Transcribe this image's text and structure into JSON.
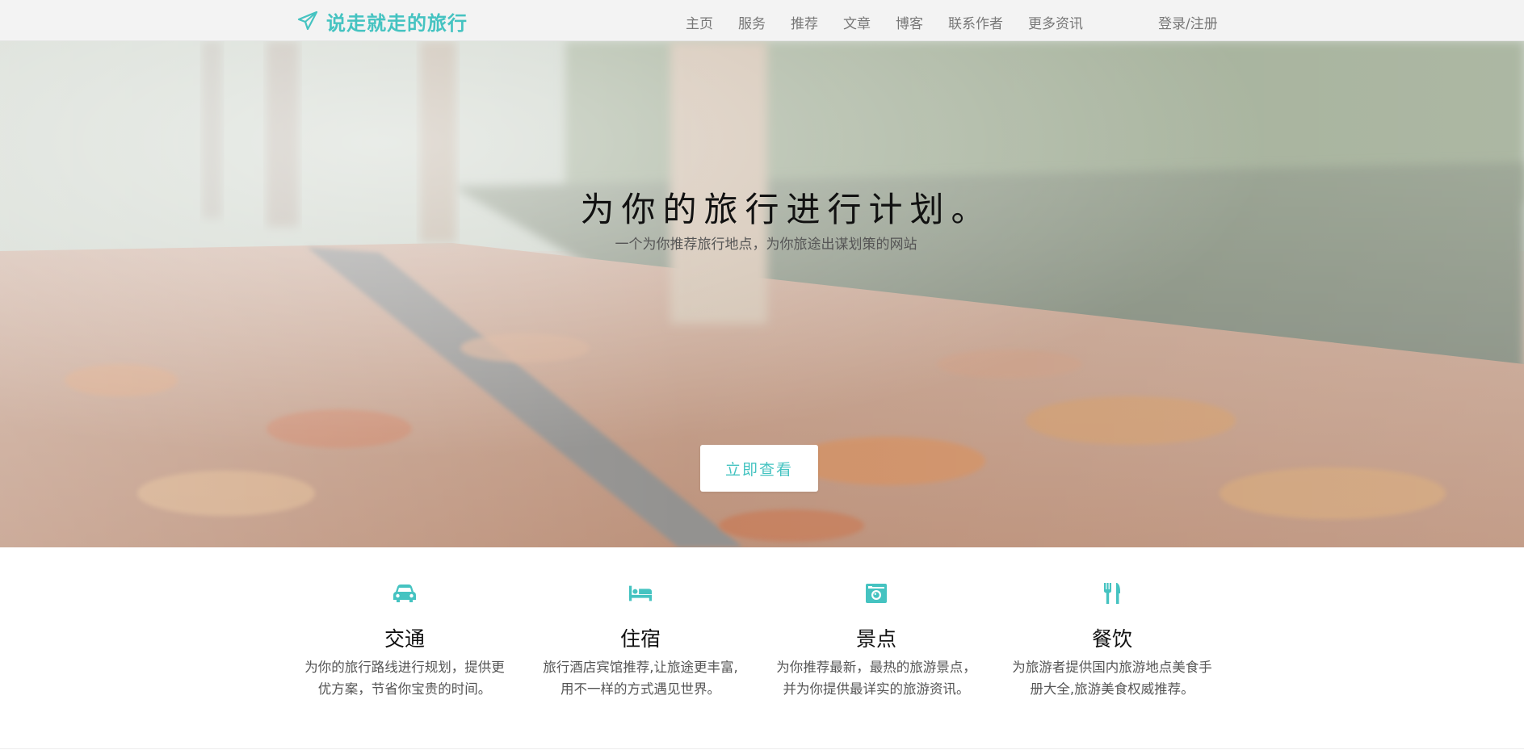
{
  "brand": {
    "name": "说走就走的旅行",
    "icon": "paper-plane-icon",
    "color": "#45c3c1"
  },
  "nav": {
    "items": [
      "主页",
      "服务",
      "推荐",
      "文章",
      "博客",
      "联系作者",
      "更多资讯"
    ],
    "login_label": "登录/注册"
  },
  "hero": {
    "title": "为你的旅行进行计划。",
    "subtitle": "一个为你推荐旅行地点，为你旅途出谋划策的网站",
    "cta_label": "立即查看",
    "background": "autumn-leaves-path-photo"
  },
  "features": [
    {
      "icon": "car-icon",
      "title": "交通",
      "desc_line1": "为你的旅行路线进行规划，提供更",
      "desc_line2": "优方案，节省你宝贵的时间。"
    },
    {
      "icon": "bed-icon",
      "title": "住宿",
      "desc_line1": "旅行酒店宾馆推荐,让旅途更丰富,",
      "desc_line2": "用不一样的方式遇见世界。"
    },
    {
      "icon": "camera-icon",
      "title": "景点",
      "desc_line1": "为你推荐最新，最热的旅游景点，",
      "desc_line2": "并为你提供最详实的旅游资讯。"
    },
    {
      "icon": "fork-knife-icon",
      "title": "餐饮",
      "desc_line1": "为旅游者提供国内旅游地点美食手",
      "desc_line2": "册大全,旅游美食权威推荐。"
    }
  ],
  "colors": {
    "accent": "#45c3c1",
    "nav_bg": "#f3f3f3",
    "nav_text": "#777777"
  }
}
